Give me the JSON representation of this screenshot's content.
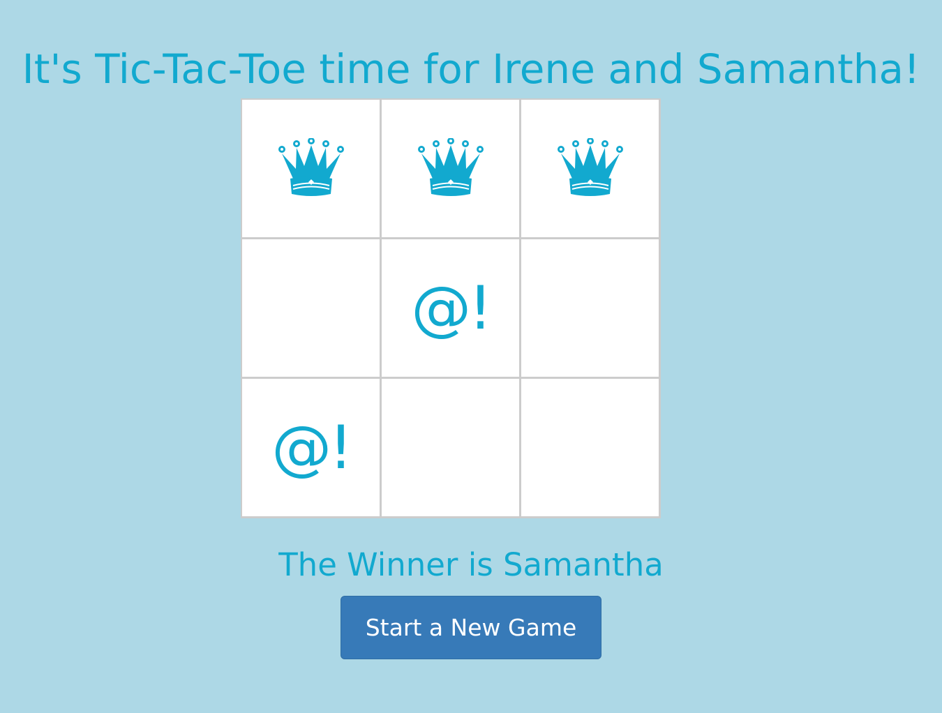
{
  "header": {
    "title": "It's Tic-Tac-Toe time for Irene and Samantha!"
  },
  "board": {
    "cells": [
      {
        "mark": "crown",
        "text": ""
      },
      {
        "mark": "crown",
        "text": ""
      },
      {
        "mark": "crown",
        "text": ""
      },
      {
        "mark": "empty",
        "text": ""
      },
      {
        "mark": "at",
        "text": "@!"
      },
      {
        "mark": "empty",
        "text": ""
      },
      {
        "mark": "at",
        "text": "@!"
      },
      {
        "mark": "empty",
        "text": ""
      },
      {
        "mark": "empty",
        "text": ""
      }
    ]
  },
  "status": {
    "winner_text": "The Winner is Samantha"
  },
  "actions": {
    "new_game_label": "Start a New Game"
  },
  "colors": {
    "background": "#add8e6",
    "accent": "#12a9cf",
    "button": "#377ab8",
    "grid": "#cccccc"
  },
  "icons": {
    "crown": "crown-icon"
  }
}
